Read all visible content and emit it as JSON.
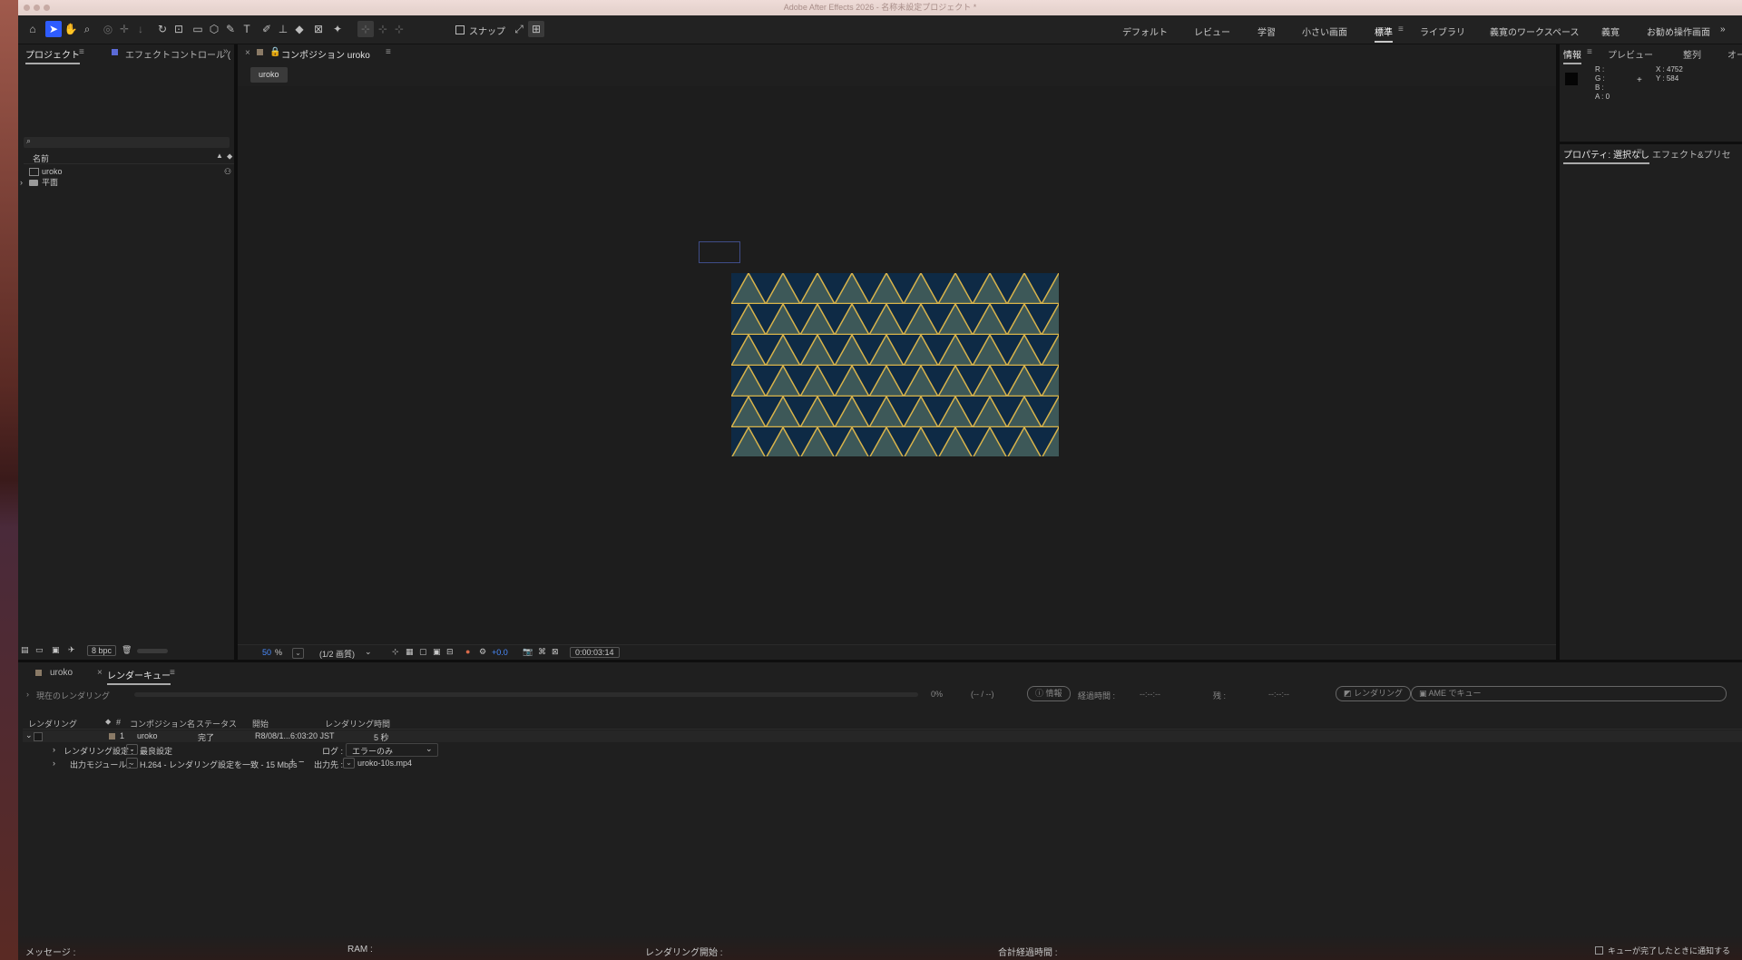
{
  "app": {
    "title": "Adobe After Effects 2026 - 名称未設定プロジェクト *"
  },
  "toolbar": {
    "snap_label": "スナップ",
    "workspaces": [
      "デフォルト",
      "レビュー",
      "学習",
      "小さい画面",
      "標準",
      "ライブラリ",
      "義寛のワークスペース",
      "義寛",
      "お勧め操作画面"
    ],
    "active_workspace": "標準"
  },
  "project": {
    "tab_label": "プロジェクト",
    "effect_tab_label": "エフェクトコントロール (",
    "column_name": "名前",
    "items": [
      {
        "label": "uroko",
        "kind": "composition"
      },
      {
        "label": "平面",
        "kind": "folder"
      }
    ],
    "bpc": "8 bpc"
  },
  "composition": {
    "tab_label": "コンポジション uroko",
    "subtab": "uroko",
    "zoom": "50",
    "zoom_unit": "%",
    "resolution": "(1/2 画質)",
    "exposure": "+0.0",
    "timecode": "0:00:03:14"
  },
  "info": {
    "tabs": [
      "情報",
      "プレビュー",
      "整列",
      "オー"
    ],
    "r_label": "R :",
    "g_label": "G :",
    "b_label": "B :",
    "a_label": "A :  0",
    "x": "X : 4752",
    "y": "Y : 584"
  },
  "properties": {
    "tab_label": "プロパティ: 選択なし",
    "effects_tab": "エフェクト&プリセ"
  },
  "bottom_tabs": {
    "comp_tab": "uroko",
    "rq_tab": "レンダーキュー"
  },
  "render_queue": {
    "current_render": "現在のレンダリング",
    "progress_pct": "0%",
    "progress_value": 0,
    "frames": "(-- / --)",
    "info_button": "情報",
    "elapsed_label": "経過時間 :",
    "elapsed_value": "--:--:--",
    "remaining_label": "残 :",
    "remaining_value": "--:--:--",
    "render_button": "レンダリング",
    "ame_button": "AME でキュー",
    "columns": [
      "レンダリング",
      "#",
      "コンポジション名",
      "ステータス",
      "開始",
      "レンダリング時間"
    ],
    "item": {
      "num": "1",
      "comp": "uroko",
      "status": "完了",
      "start": "R8/08/1...6:03:20 JST",
      "duration": "5 秒"
    },
    "render_settings_label": "レンダリング設定 :",
    "render_settings_value": "最良設定",
    "log_label": "ログ :",
    "log_value": "エラーのみ",
    "output_module_label": "出力モジュール :",
    "output_module_value": "H.264 - レンダリング設定を一致 - 15 Mbps",
    "output_to_label": "出力先 :",
    "output_to_value": "uroko-10s.mp4"
  },
  "status_bar": {
    "message": "メッセージ :",
    "ram": "RAM :",
    "render_start": "レンダリング開始 :",
    "total_elapsed": "合計経過時間 :",
    "notify": "キューが完了したときに通知する"
  },
  "colors": {
    "accent": "#2e5cff",
    "pattern_dark": "#0e2a45",
    "pattern_light": "#3d5858",
    "pattern_line": "#d9b44a"
  }
}
